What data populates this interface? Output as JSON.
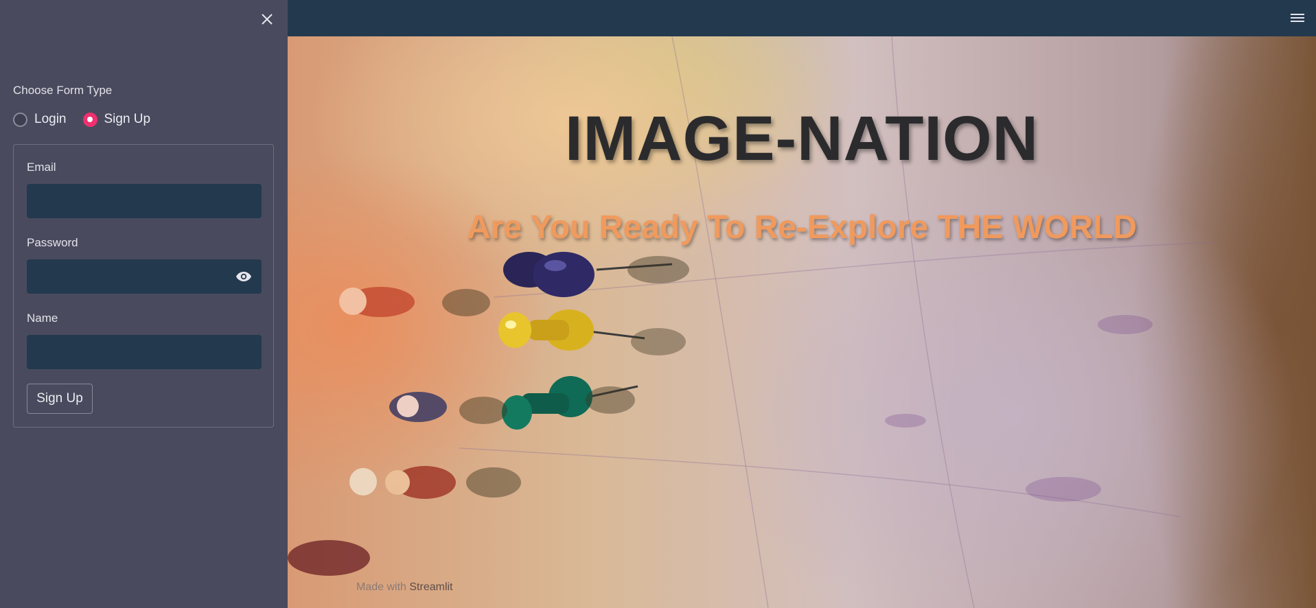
{
  "sidebar": {
    "form_type_label": "Choose Form Type",
    "radio_options": [
      {
        "label": "Login",
        "selected": false
      },
      {
        "label": "Sign Up",
        "selected": true
      }
    ],
    "fields": {
      "email": {
        "label": "Email",
        "value": "",
        "placeholder": ""
      },
      "password": {
        "label": "Password",
        "value": "",
        "placeholder": ""
      },
      "name": {
        "label": "Name",
        "value": "",
        "placeholder": ""
      }
    },
    "submit_label": "Sign Up",
    "icons": {
      "close": "close-icon",
      "eye": "eye-icon"
    }
  },
  "header": {
    "menu_icon": "hamburger-menu-icon"
  },
  "hero": {
    "title": "IMAGE-NATION",
    "subtitle": "Are You Ready To Re-Explore THE WORLD"
  },
  "footer": {
    "prefix": "Made with",
    "brand": "Streamlit"
  },
  "colors": {
    "sidebar_bg": "#4a4a5e",
    "topbar_bg": "#23394e",
    "input_bg": "#23394e",
    "radio_accent": "#f0306f",
    "title_color": "#2b2b2d",
    "subtitle_color": "#f09a5e"
  }
}
